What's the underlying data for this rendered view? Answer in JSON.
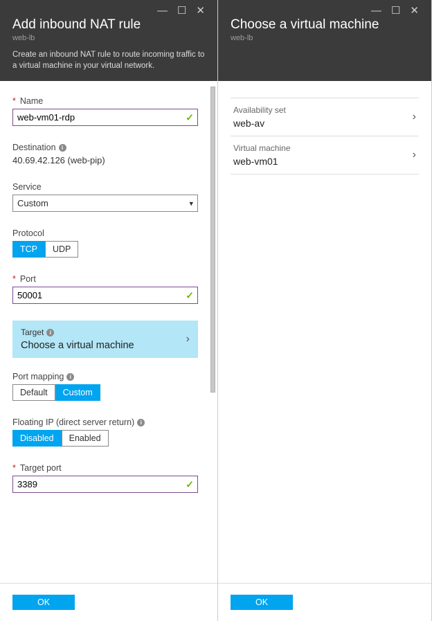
{
  "left": {
    "title": "Add inbound NAT rule",
    "subtitle": "web-lb",
    "description": "Create an inbound NAT rule to route incoming traffic to a virtual machine in your virtual network.",
    "name": {
      "label": "Name",
      "value": "web-vm01-rdp"
    },
    "destination": {
      "label": "Destination",
      "value": "40.69.42.126 (web-pip)"
    },
    "service": {
      "label": "Service",
      "value": "Custom"
    },
    "protocol": {
      "label": "Protocol",
      "options": [
        "TCP",
        "UDP"
      ],
      "selected": "TCP"
    },
    "port": {
      "label": "Port",
      "value": "50001"
    },
    "target": {
      "label": "Target",
      "value": "Choose a virtual machine"
    },
    "portMapping": {
      "label": "Port mapping",
      "options": [
        "Default",
        "Custom"
      ],
      "selected": "Custom"
    },
    "floatingIp": {
      "label": "Floating IP (direct server return)",
      "options": [
        "Disabled",
        "Enabled"
      ],
      "selected": "Disabled"
    },
    "targetPort": {
      "label": "Target port",
      "value": "3389"
    },
    "ok": "OK"
  },
  "right": {
    "title": "Choose a virtual machine",
    "subtitle": "web-lb",
    "availabilitySet": {
      "label": "Availability set",
      "value": "web-av"
    },
    "virtualMachine": {
      "label": "Virtual machine",
      "value": "web-vm01"
    },
    "ok": "OK"
  }
}
